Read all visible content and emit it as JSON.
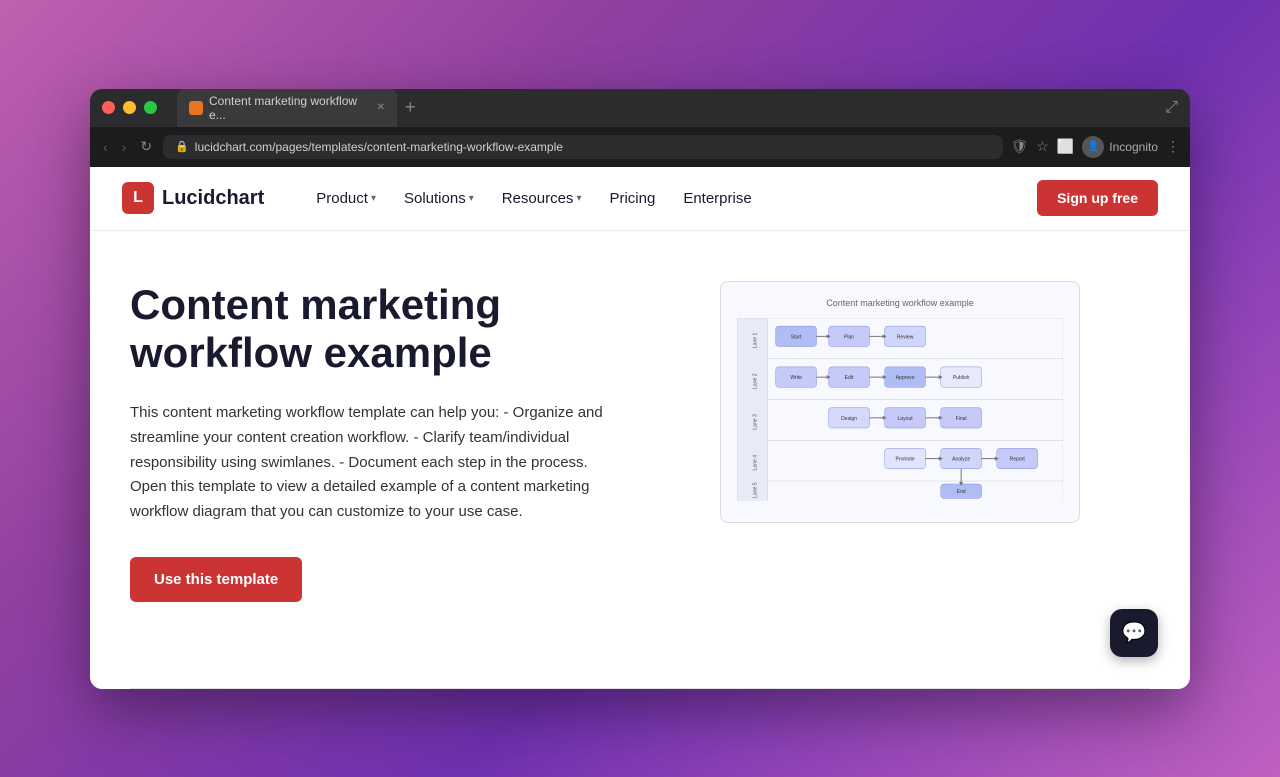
{
  "browser": {
    "tab_title": "Content marketing workflow e...",
    "url": "lucidchart.com/pages/templates/content-marketing-workflow-example",
    "incognito_label": "Incognito",
    "new_tab_icon": "+",
    "window_expand_icon": "⤢"
  },
  "nav": {
    "logo_text": "Lucidchart",
    "product_label": "Product",
    "solutions_label": "Solutions",
    "resources_label": "Resources",
    "pricing_label": "Pricing",
    "enterprise_label": "Enterprise",
    "signup_label": "Sign up free"
  },
  "main": {
    "title": "Content marketing workflow example",
    "description": "This content marketing workflow template can help you: - Organize and streamline your content creation workflow. - Clarify team/individual responsibility using swimlanes. - Document each step in the process. Open this template to view a detailed example of a content marketing workflow diagram that you can customize to your use case.",
    "cta_label": "Use this template",
    "diagram_title": "Content marketing workflow example"
  },
  "chat": {
    "icon": "💬"
  }
}
